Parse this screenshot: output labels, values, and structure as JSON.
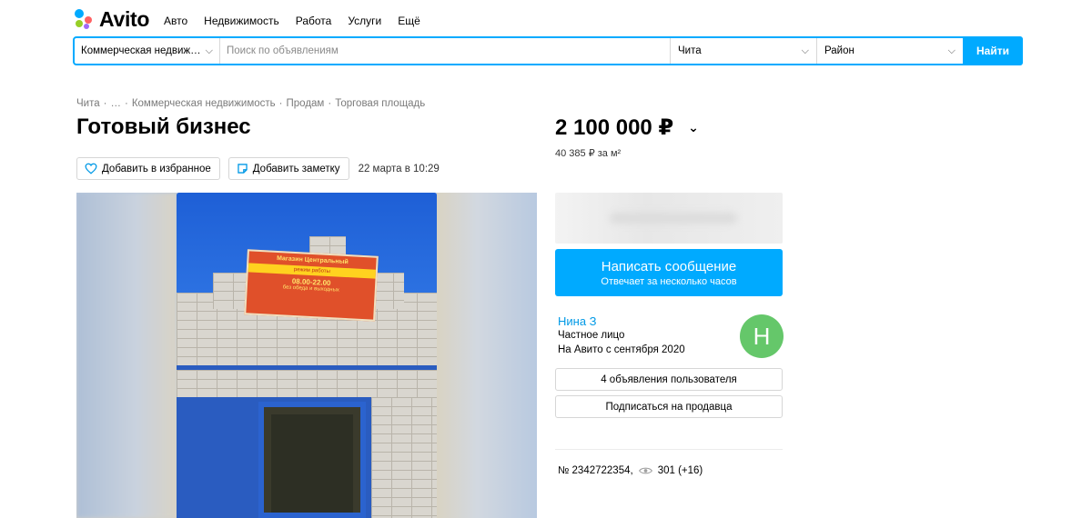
{
  "brand": {
    "name": "Avito",
    "dot_colors": [
      "#97cf26",
      "#0af",
      "#ff6163",
      "#a169f7"
    ]
  },
  "topnav": [
    "Авто",
    "Недвижимость",
    "Работа",
    "Услуги",
    "Ещё"
  ],
  "search": {
    "category": "Коммерческая недвиж…",
    "placeholder": "Поиск по объявлениям",
    "city": "Чита",
    "district": "Район",
    "button": "Найти"
  },
  "breadcrumbs": [
    "Чита",
    "…",
    "Коммерческая недвижимость",
    "Продам",
    "Торговая площадь"
  ],
  "listing": {
    "title": "Готовый бизнес",
    "price": "2 100 000 ₽",
    "price_per_m": "40 385 ₽ за м²",
    "favorite_label": "Добавить в избранное",
    "note_label": "Добавить заметку",
    "date": "22 марта в 10:29",
    "id_text": "№ 2342722354,",
    "views": "301 (+16)"
  },
  "photo_sign": {
    "line1": "Магазин Центральный",
    "line2": "режим работы",
    "hours": "08.00-22.00",
    "line3": "без обеда и выходных"
  },
  "seller": {
    "message_button": "Написать сообщение",
    "message_sub": "Отвечает за несколько часов",
    "name": "Нина З",
    "type": "Частное лицо",
    "since": "На Авито с сентября 2020",
    "avatar_letter": "Н",
    "avatar_color": "#65c76a",
    "listings_button": "4 объявления пользователя",
    "subscribe_button": "Подписаться на продавца"
  },
  "colors": {
    "accent": "#00aaff",
    "link": "#0099e6"
  }
}
